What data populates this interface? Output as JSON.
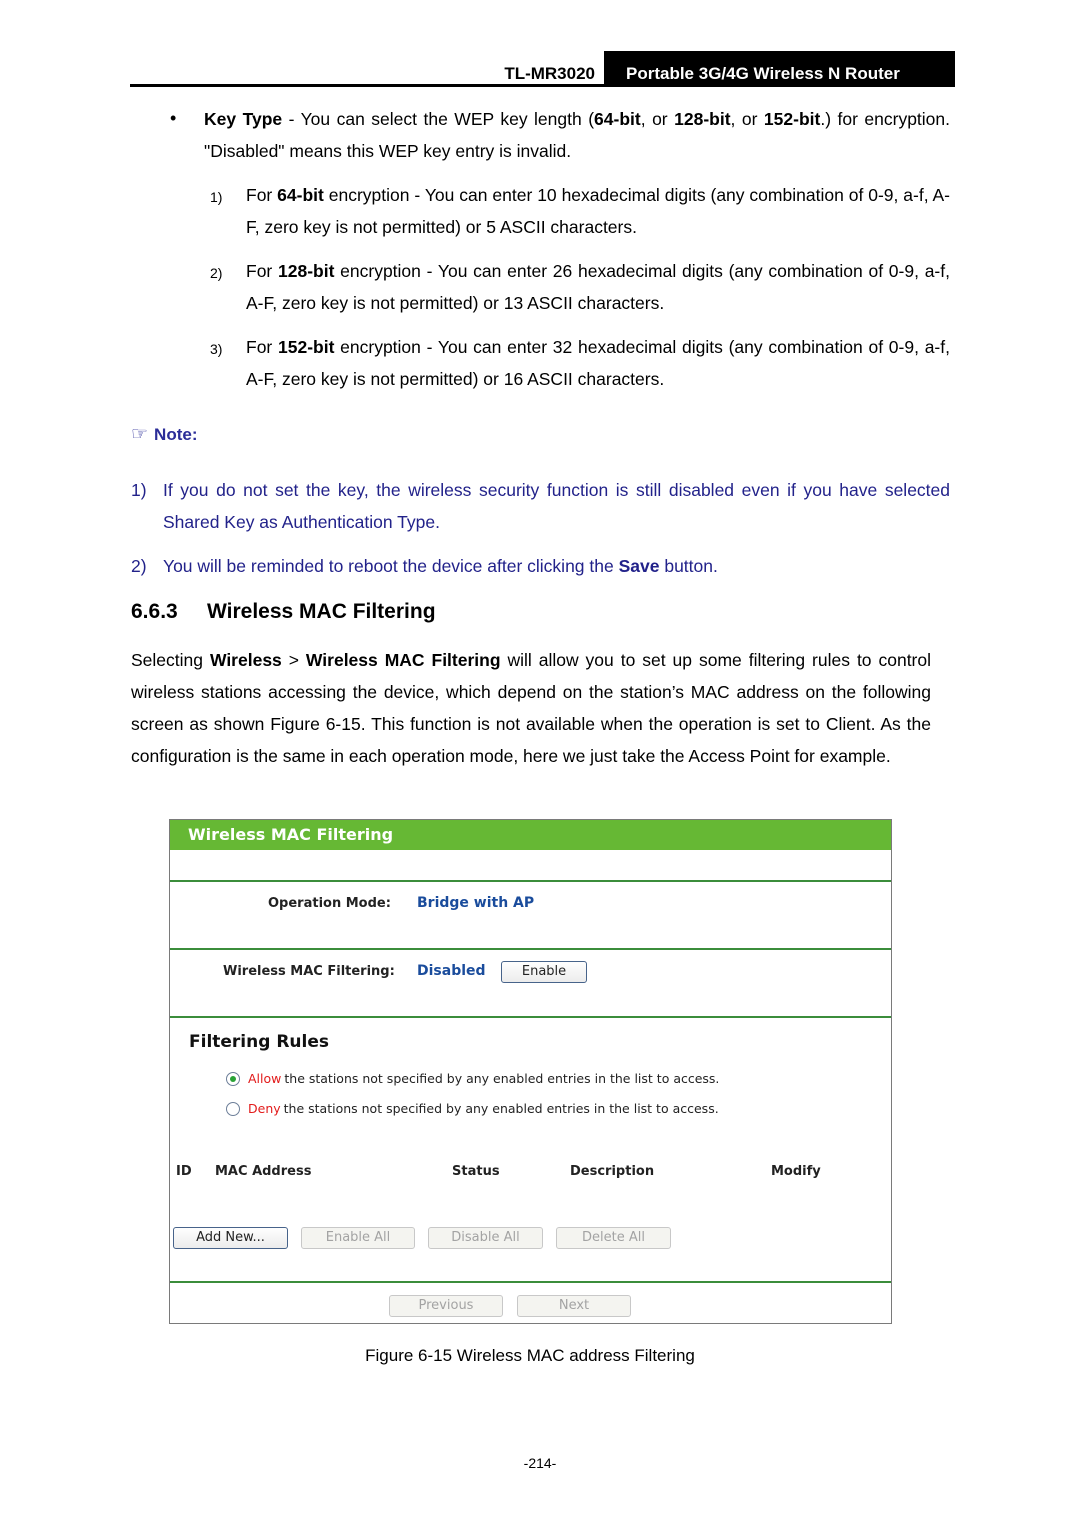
{
  "header": {
    "model": "TL-MR3020",
    "product": "Portable 3G/4G Wireless N Router"
  },
  "key_type": {
    "bullet": "•",
    "term": "Key Type",
    "text_1": " - You can select the WEP key length (",
    "b1": "64-bit",
    "text_2": ", or ",
    "b2": "128-bit",
    "text_3": ", or ",
    "b3": "152-bit",
    "text_4": ".) for encryption. \"Disabled\" means this WEP key entry is invalid.",
    "items": [
      {
        "num": "1)",
        "pre": "For ",
        "bold": "64-bit",
        "text": " encryption - You can enter 10 hexadecimal digits (any combination of 0-9, a-f, A-F, zero key is not permitted) or 5 ASCII characters."
      },
      {
        "num": "2)",
        "pre": "For ",
        "bold": "128-bit",
        "text": " encryption - You can enter 26 hexadecimal digits (any combination of 0-9, a-f, A-F, zero key is not permitted) or 13 ASCII characters."
      },
      {
        "num": "3)",
        "pre": "For ",
        "bold": "152-bit",
        "text": " encryption - You can enter 32 hexadecimal digits (any combination of 0-9, a-f, A-F, zero key is not permitted) or 16 ASCII characters."
      }
    ]
  },
  "note": {
    "icon": "☞",
    "title": "Note:",
    "items": [
      {
        "num": "1)",
        "text": "If you do not set the key, the wireless security function is still disabled even if you have selected Shared Key as Authentication Type."
      },
      {
        "num": "2)",
        "pre": "You will be reminded to reboot the device after clicking the ",
        "bold": "Save",
        "post": " button."
      }
    ]
  },
  "section": {
    "number": "6.6.3",
    "title": "Wireless MAC Filtering",
    "p_pre": "Selecting ",
    "p_b1": "Wireless",
    "p_mid": " > ",
    "p_b2": "Wireless MAC Filtering",
    "p_post": " will allow you to set up some filtering rules to control wireless stations accessing the device, which depend on the station’s MAC address on the following screen as shown Figure 6-15. This function is not available when the operation is set to Client. As the configuration is the same in each operation mode, here we just take the Access Point for example."
  },
  "figure": {
    "panel_title": "Wireless MAC Filtering",
    "operation_mode_label": "Operation Mode:",
    "operation_mode_value": "Bridge with AP",
    "filtering_label": "Wireless MAC Filtering:",
    "filtering_value": "Disabled",
    "enable_button": "Enable",
    "rules_title": "Filtering Rules",
    "rules": [
      {
        "keyword": "Allow",
        "text": "the stations not specified by any enabled entries in the list to access.",
        "selected": true
      },
      {
        "keyword": "Deny",
        "text": "the stations not specified by any enabled entries in the list to access.",
        "selected": false
      }
    ],
    "columns": [
      "ID",
      "MAC Address",
      "Status",
      "Description",
      "Modify"
    ],
    "buttons": {
      "add_new": "Add New...",
      "enable_all": "Enable All",
      "disable_all": "Disable All",
      "delete_all": "Delete All",
      "previous": "Previous",
      "next": "Next"
    },
    "colors": {
      "header_green": "#66b834",
      "divider_green": "#3b8d3b",
      "value_blue": "#1a4c9c",
      "keyword_red": "#e21b1b"
    }
  },
  "caption": "Figure 6-15 Wireless MAC address Filtering",
  "page_number": "-214-"
}
